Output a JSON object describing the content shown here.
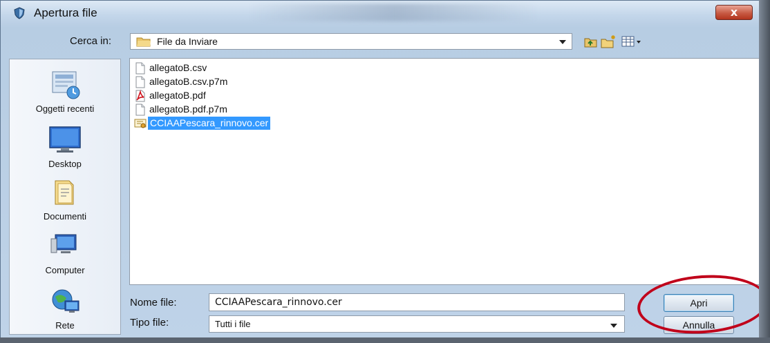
{
  "window": {
    "title": "Apertura file",
    "close_glyph": "x",
    "title_icon": "shield-icon"
  },
  "toolbar": {
    "lookin_label": "Cerca in:",
    "lookin_value": "File da Inviare",
    "lookin_icon": "folder-icon",
    "buttons": [
      {
        "icon": "up-one-level-icon"
      },
      {
        "icon": "new-folder-icon"
      },
      {
        "icon": "view-menu-icon"
      }
    ]
  },
  "places": [
    {
      "label": "Oggetti recenti",
      "icon": "recent-items-icon"
    },
    {
      "label": "Desktop",
      "icon": "desktop-icon"
    },
    {
      "label": "Documenti",
      "icon": "documents-icon"
    },
    {
      "label": "Computer",
      "icon": "computer-icon"
    },
    {
      "label": "Rete",
      "icon": "network-icon"
    }
  ],
  "files": [
    {
      "name": "allegatoB.csv",
      "icon": "document-icon",
      "selected": false
    },
    {
      "name": "allegatoB.csv.p7m",
      "icon": "document-icon",
      "selected": false
    },
    {
      "name": "allegatoB.pdf",
      "icon": "pdf-icon",
      "selected": false
    },
    {
      "name": "allegatoB.pdf.p7m",
      "icon": "document-icon",
      "selected": false
    },
    {
      "name": "CCIAAPescara_rinnovo.cer",
      "icon": "certificate-icon",
      "selected": true
    }
  ],
  "form": {
    "filename_label": "Nome file:",
    "filename_value": "CCIAAPescara_rinnovo.cer",
    "filetype_label": "Tipo file:",
    "filetype_value": "Tutti i file",
    "open_label": "Apri",
    "cancel_label": "Annulla"
  },
  "colors": {
    "selection": "#3399ff",
    "annotation": "#c0001a",
    "close_button": "#c75b44"
  }
}
